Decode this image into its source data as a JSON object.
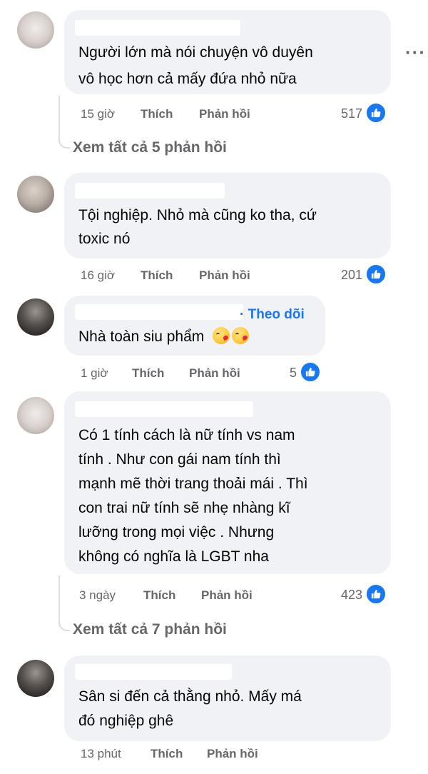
{
  "comments": [
    {
      "lines": [
        "Người lớn mà nói chuyện vô duyên",
        "vô học hơn cả mấy đứa nhỏ nữa"
      ],
      "time": "15 giờ",
      "like_label": "Thích",
      "reply_label": "Phản hồi",
      "reactions": "517",
      "view_replies": "Xem tất cả 5 phản hồi"
    },
    {
      "lines": [
        "Tội nghiệp. Nhỏ mà cũng ko tha, cứ",
        "toxic nó"
      ],
      "time": "16 giờ",
      "like_label": "Thích",
      "reply_label": "Phản hồi",
      "reactions": "201"
    },
    {
      "follow_label": "· Theo dõi",
      "lines": [
        "Nhà toàn siu phẩm"
      ],
      "time": "1 giờ",
      "like_label": "Thích",
      "reply_label": "Phản hồi",
      "reactions": "5"
    },
    {
      "lines": [
        "Có 1 tính cách là nữ tính vs nam",
        "tính . Như con gái nam tính thì",
        "mạnh mẽ thời trang thoải mái . Thì",
        "con trai nữ tính sẽ nhẹ nhàng kĩ",
        "lưỡng trong mọi việc . Nhưng",
        "không có nghĩa là LGBT nha"
      ],
      "time": "3 ngày",
      "like_label": "Thích",
      "reply_label": "Phản hồi",
      "reactions": "423",
      "view_replies": "Xem tất cả 7 phản hồi"
    },
    {
      "lines": [
        "Sân si đến cả thằng nhỏ. Mấy má",
        "đó nghiệp ghê"
      ],
      "time": "13 phút",
      "like_label": "Thích",
      "reply_label": "Phản hồi"
    }
  ],
  "more_icon": "more-horizontal-icon",
  "colors": {
    "bubble": "#f0f2f5",
    "link": "#1877f2",
    "meta": "#65676b"
  }
}
